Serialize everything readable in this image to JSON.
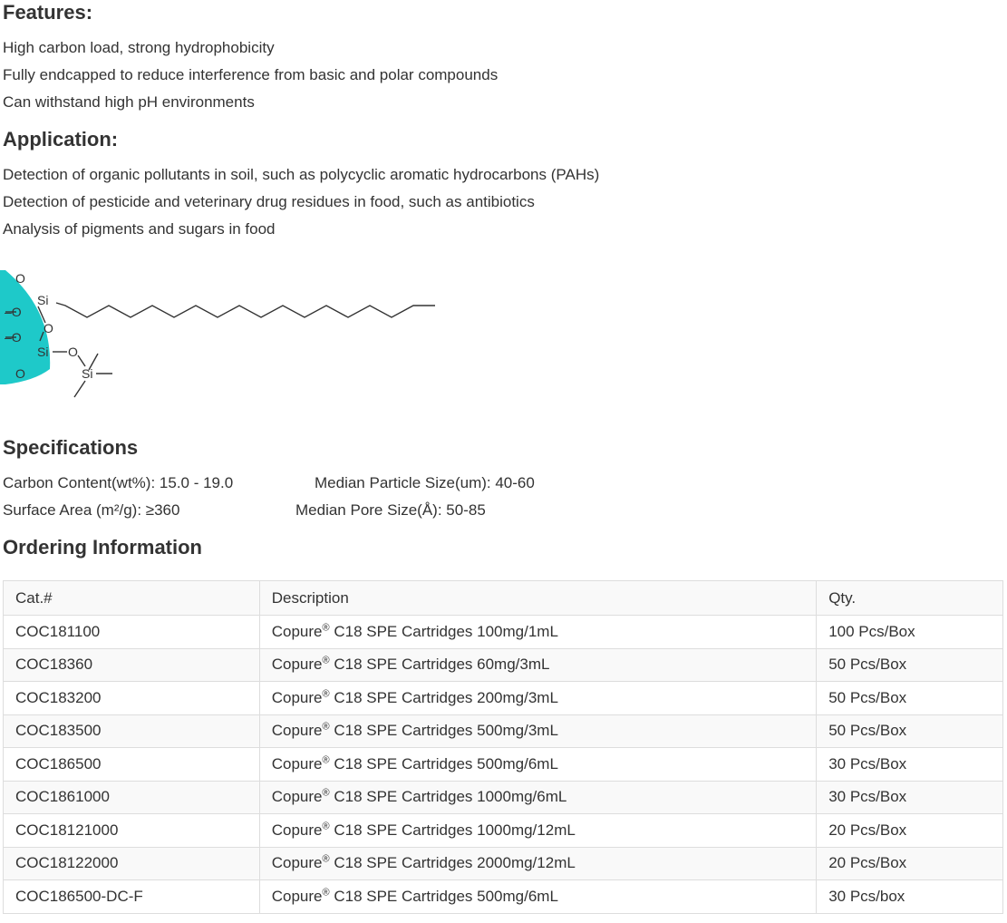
{
  "features": {
    "heading": "Features:",
    "items": [
      "High carbon load, strong hydrophobicity",
      "Fully endcapped to reduce interference from basic and polar compounds",
      "Can withstand high pH environments"
    ]
  },
  "application": {
    "heading": "Application:",
    "items": [
      "Detection of organic pollutants in soil, such as polycyclic aromatic hydrocarbons (PAHs)",
      "Detection of pesticide and veterinary drug residues in food, such as antibiotics",
      "Analysis of pigments and sugars in food"
    ]
  },
  "structure": {
    "atom_o": "O",
    "atom_si": "Si",
    "bond_o": "–O",
    "fill_color": "#1ec9c9"
  },
  "specifications": {
    "heading": "Specifications",
    "carbon_content": "Carbon Content(wt%): 15.0 - 19.0",
    "particle_size": "Median Particle Size(um): 40-60",
    "surface_area": "Surface Area (m²/g): ≥360",
    "pore_size": "Median Pore Size(Å): 50-85"
  },
  "ordering": {
    "heading": "Ordering Information",
    "columns": [
      "Cat.#",
      "Description",
      "Qty."
    ],
    "brand": "Copure",
    "registered": "®",
    "rows": [
      {
        "cat": "COC181100",
        "desc": " C18 SPE Cartridges 100mg/1mL",
        "qty": "100 Pcs/Box"
      },
      {
        "cat": "COC18360",
        "desc": " C18 SPE Cartridges 60mg/3mL",
        "qty": "50 Pcs/Box"
      },
      {
        "cat": "COC183200",
        "desc": " C18 SPE Cartridges 200mg/3mL",
        "qty": "50 Pcs/Box"
      },
      {
        "cat": "COC183500",
        "desc": " C18 SPE Cartridges 500mg/3mL",
        "qty": "50 Pcs/Box"
      },
      {
        "cat": "COC186500",
        "desc": " C18 SPE Cartridges 500mg/6mL",
        "qty": "30 Pcs/Box"
      },
      {
        "cat": "COC1861000",
        "desc": " C18 SPE Cartridges 1000mg/6mL",
        "qty": "30 Pcs/Box"
      },
      {
        "cat": "COC18121000",
        "desc": " C18 SPE Cartridges 1000mg/12mL",
        "qty": "20 Pcs/Box"
      },
      {
        "cat": "COC18122000",
        "desc": " C18 SPE Cartridges 2000mg/12mL",
        "qty": "20 Pcs/Box"
      },
      {
        "cat": "COC186500-DC-F",
        "desc": " C18 SPE Cartridges 500mg/6mL",
        "qty": "30 Pcs/box"
      }
    ]
  }
}
